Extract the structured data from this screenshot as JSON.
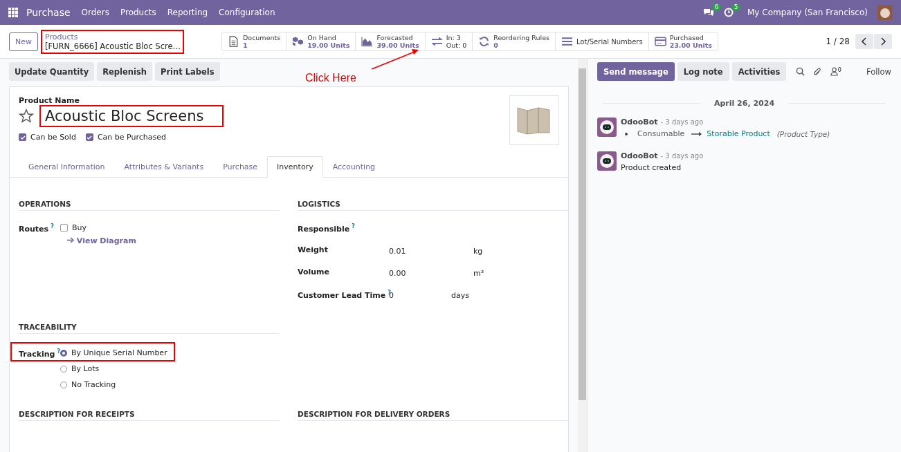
{
  "navbar": {
    "app": "Purchase",
    "menus": [
      "Orders",
      "Products",
      "Reporting",
      "Configuration"
    ],
    "messages_badge": "6",
    "activities_badge": "5",
    "company": "My Company (San Francisco)"
  },
  "control_panel": {
    "new_button": "New",
    "breadcrumb": "Products",
    "record": "[FURN_6666] Acoustic Bloc Scre…",
    "pager": "1 / 28"
  },
  "smart_buttons": [
    {
      "kind": "document",
      "label": "Documents",
      "value": "1"
    },
    {
      "kind": "cubes",
      "label": "On Hand",
      "value": "19.00 Units"
    },
    {
      "kind": "area",
      "label": "Forecasted",
      "value": "39.00 Units"
    },
    {
      "kind": "inout",
      "label": "In: 3",
      "value": "Out: 0"
    },
    {
      "kind": "refresh",
      "label": "Reordering Rules",
      "value": "0"
    },
    {
      "kind": "list",
      "label": "Lot/Serial Numbers"
    },
    {
      "kind": "card",
      "label": "Purchased",
      "value": "23.00 Units"
    }
  ],
  "actions": [
    "Update Quantity",
    "Replenish",
    "Print Labels"
  ],
  "annotation": "Click Here",
  "form": {
    "name_label": "Product Name",
    "name": "Acoustic Bloc Screens",
    "favorite": false,
    "flags": [
      {
        "label": "Can be Sold",
        "checked": true
      },
      {
        "label": "Can be Purchased",
        "checked": true
      }
    ],
    "tabs": [
      {
        "label": "General Information",
        "selected": false
      },
      {
        "label": "Attributes & Variants",
        "selected": false
      },
      {
        "label": "Purchase",
        "selected": false
      },
      {
        "label": "Inventory",
        "selected": true
      },
      {
        "label": "Accounting",
        "selected": false
      }
    ],
    "operations": {
      "title": "OPERATIONS",
      "routes_label": "Routes",
      "help": "?",
      "routes": [
        {
          "label": "Buy",
          "checked": false
        }
      ],
      "link": "View Diagram"
    },
    "logistics": {
      "title": "LOGISTICS",
      "responsible_label": "Responsible",
      "help": "?",
      "fields": [
        {
          "label": "Weight",
          "value": "0.01",
          "unit": "kg"
        },
        {
          "label": "Volume",
          "value": "0.00",
          "unit": "m³"
        },
        {
          "label": "Customer Lead Time",
          "help": "?",
          "value": "0",
          "unit": "days"
        }
      ]
    },
    "traceability": {
      "title": "TRACEABILITY",
      "label": "Tracking",
      "help": "?",
      "options": [
        {
          "label": "By Unique Serial Number",
          "selected": true
        },
        {
          "label": "By Lots",
          "selected": false
        },
        {
          "label": "No Tracking",
          "selected": false
        }
      ]
    },
    "descriptions": [
      "DESCRIPTION FOR RECEIPTS",
      "DESCRIPTION FOR DELIVERY ORDERS"
    ]
  },
  "chatter": {
    "buttons": [
      "Send message",
      "Log note",
      "Activities"
    ],
    "followers": "0",
    "follow": "Follow",
    "date": "April 26, 2024",
    "messages": [
      {
        "author": "OdooBot",
        "time": "- 3 days ago",
        "kind": "change",
        "old": "Consumable",
        "new": "Storable Product",
        "field": "(Product Type)"
      },
      {
        "author": "OdooBot",
        "time": "- 3 days ago",
        "kind": "text",
        "body": "Product created"
      }
    ]
  }
}
